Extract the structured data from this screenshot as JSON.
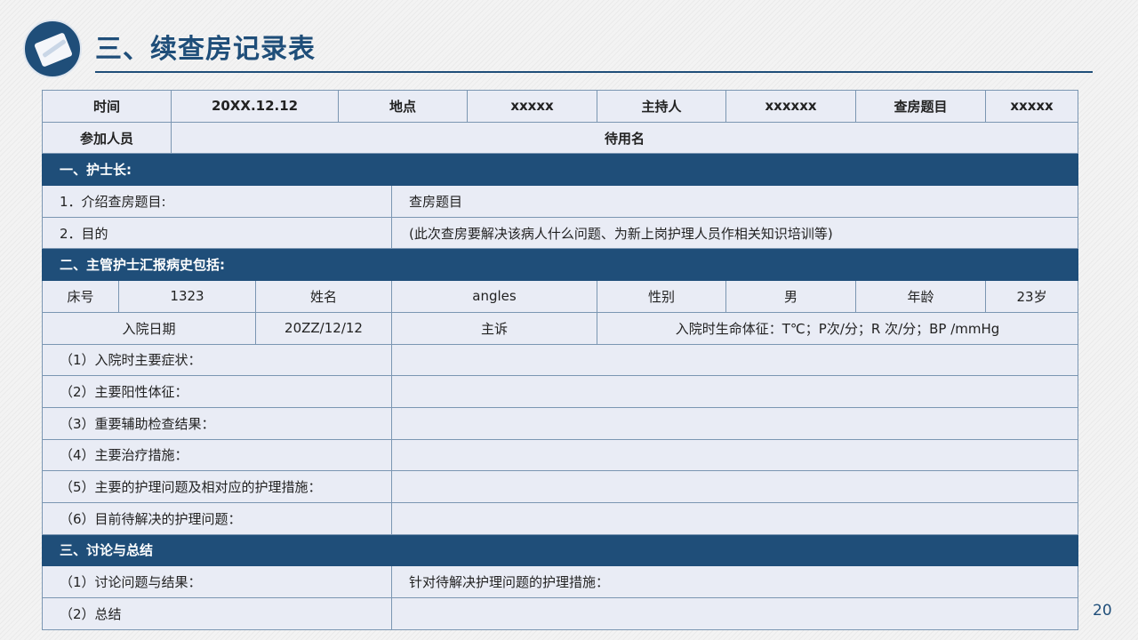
{
  "header": {
    "title": "三、续查房记录表",
    "icon": "doctor-writing-icon",
    "accent_color": "#1f4e79"
  },
  "form": {
    "info": {
      "time_label": "时间",
      "time_value": "20XX.12.12",
      "place_label": "地点",
      "place_value": "xxxxx",
      "host_label": "主持人",
      "host_value": "xxxxxx",
      "topic_label": "查房题目",
      "topic_value": "xxxxx",
      "attendees_label": "参加人员",
      "attendees_value": "待用名"
    },
    "section1": {
      "title": "一、护士长:",
      "intro_label": "1．介绍查房题目:",
      "intro_value": "查房题目",
      "purpose_label": "2．目的",
      "purpose_value": "(此次查房要解决该病人什么问题、为新上岗护理人员作相关知识培训等)"
    },
    "section2": {
      "title": "二、主管护士汇报病史包括:",
      "bed_label": "床号",
      "bed_value": "1323",
      "name_label": "姓名",
      "name_value": "angles",
      "gender_label": "性别",
      "gender_value": "男",
      "age_label": "年龄",
      "age_value": "23岁",
      "admit_date_label": "入院日期",
      "admit_date_value": "20ZZ/12/12",
      "complaint_label": "主诉",
      "vitals": "入院时生命体征：T℃；P次/分；R 次/分；BP /mmHg",
      "items": [
        "（1）入院时主要症状：",
        "（2）主要阳性体征：",
        "（3）重要辅助检查结果：",
        "（4）主要治疗措施：",
        "（5）主要的护理问题及相对应的护理措施：",
        "（6）目前待解决的护理问题："
      ]
    },
    "section3": {
      "title": "三、讨论与总结",
      "discussion_label": "（1）讨论问题与结果：",
      "measures_label": "针对待解决护理问题的护理措施：",
      "summary_label": "（2）总结"
    }
  },
  "page_number": "20"
}
